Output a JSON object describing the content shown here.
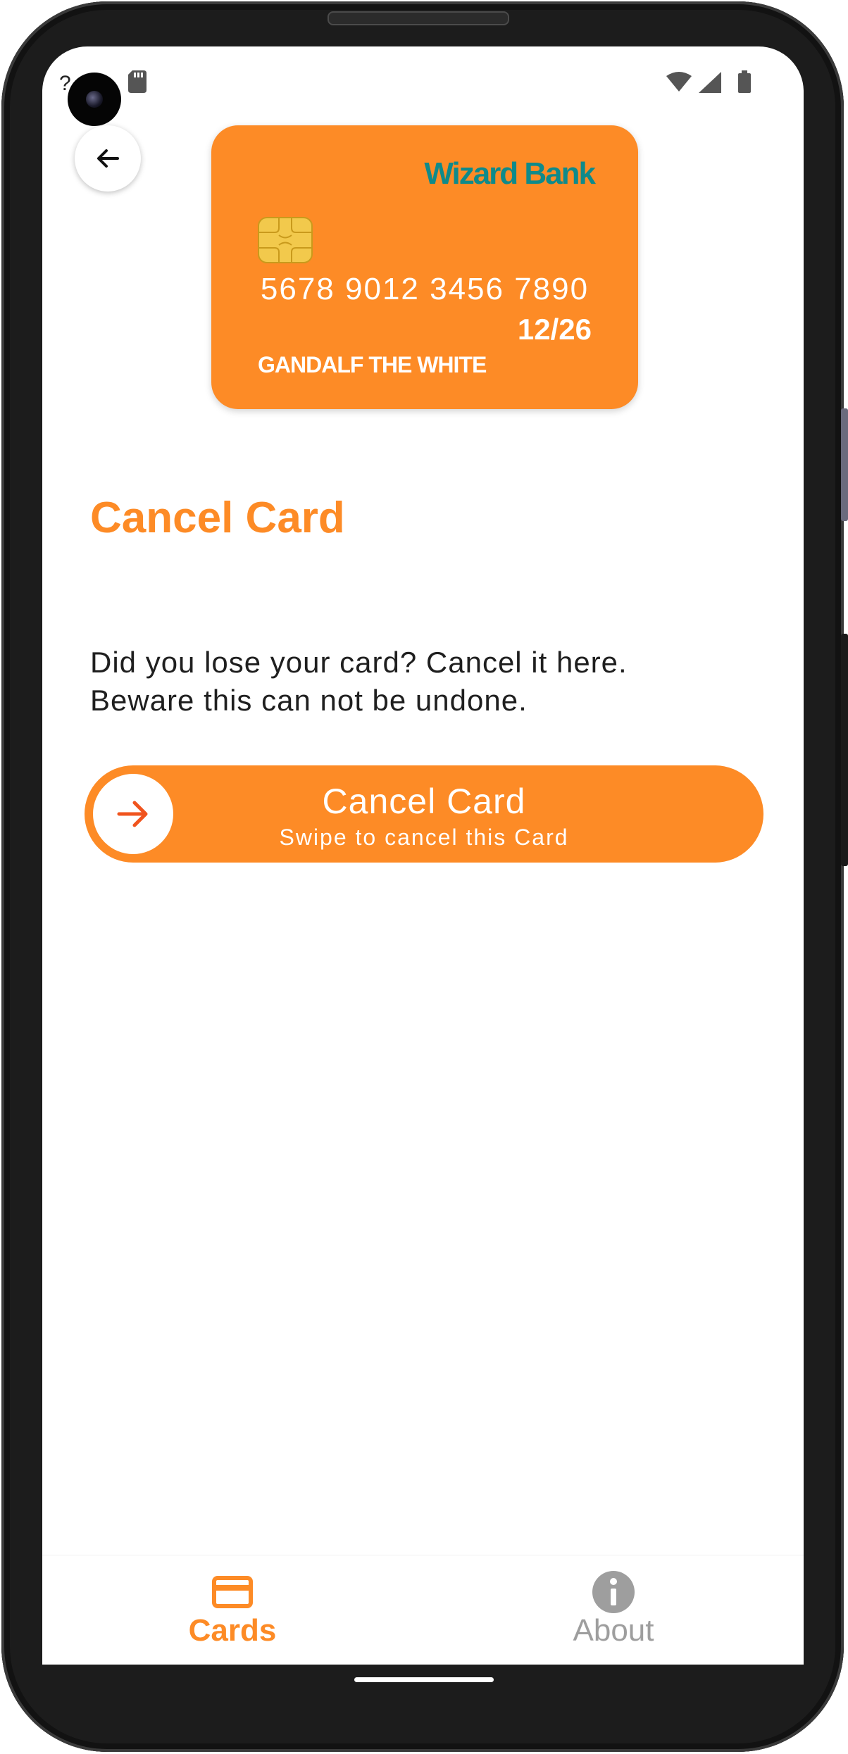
{
  "status_bar": {
    "left_text": "?",
    "sd_icon": "sd-card-icon",
    "wifi_icon": "wifi-icon",
    "signal_icon": "signal-icon",
    "battery_icon": "battery-icon"
  },
  "header": {
    "back_icon": "arrow-left-icon"
  },
  "card": {
    "bank_name": "Wizard Bank",
    "number": "5678 9012 3456 7890",
    "expiry": "12/26",
    "holder": "GANDALF THE WHITE",
    "color": "#fd8b26",
    "bank_color": "#0f8a8a"
  },
  "main": {
    "title": "Cancel Card",
    "description_line1": "Did you lose your card? Cancel it here.",
    "description_line2": "Beware this can not be undone."
  },
  "swipe_button": {
    "title": "Cancel Card",
    "subtitle": "Swipe to cancel this Card",
    "knob_icon": "arrow-right-icon"
  },
  "bottom_nav": {
    "items": [
      {
        "label": "Cards",
        "icon": "credit-card-icon",
        "active": true
      },
      {
        "label": "About",
        "icon": "info-icon",
        "active": false
      }
    ]
  },
  "colors": {
    "accent": "#fd8b26",
    "inactive": "#9e9e9e"
  }
}
